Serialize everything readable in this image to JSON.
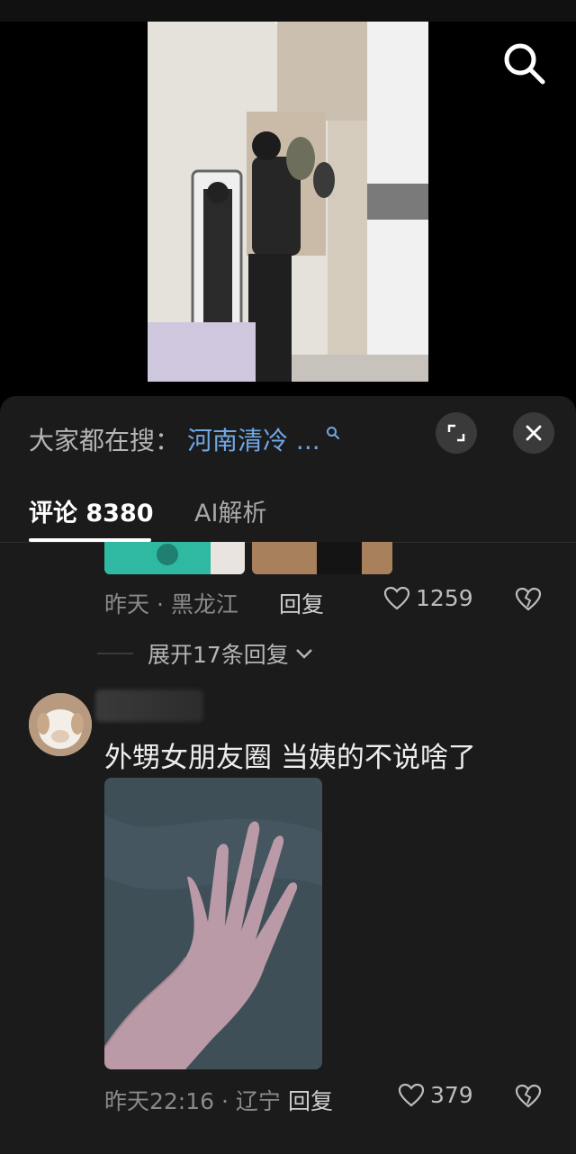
{
  "video": {
    "search_icon": "search-icon"
  },
  "sheet": {
    "hot_search_prefix": "大家都在搜：",
    "hot_search_term": "河南清冷 ...",
    "tabs": [
      {
        "label": "评论 8380",
        "active": true
      },
      {
        "label": "AI解析",
        "active": false
      }
    ],
    "colors": {
      "link": "#6fa8e6",
      "background": "#1b1b1b"
    }
  },
  "comments": [
    {
      "meta": "昨天 · 黑龙江",
      "reply_label": "回复",
      "likes": "1259",
      "expand_label": "展开17条回复"
    },
    {
      "text": "外甥女朋友圈 当姨的不说啥了",
      "meta": "昨天22:16 · 辽宁",
      "reply_label": "回复",
      "likes": "379"
    }
  ]
}
